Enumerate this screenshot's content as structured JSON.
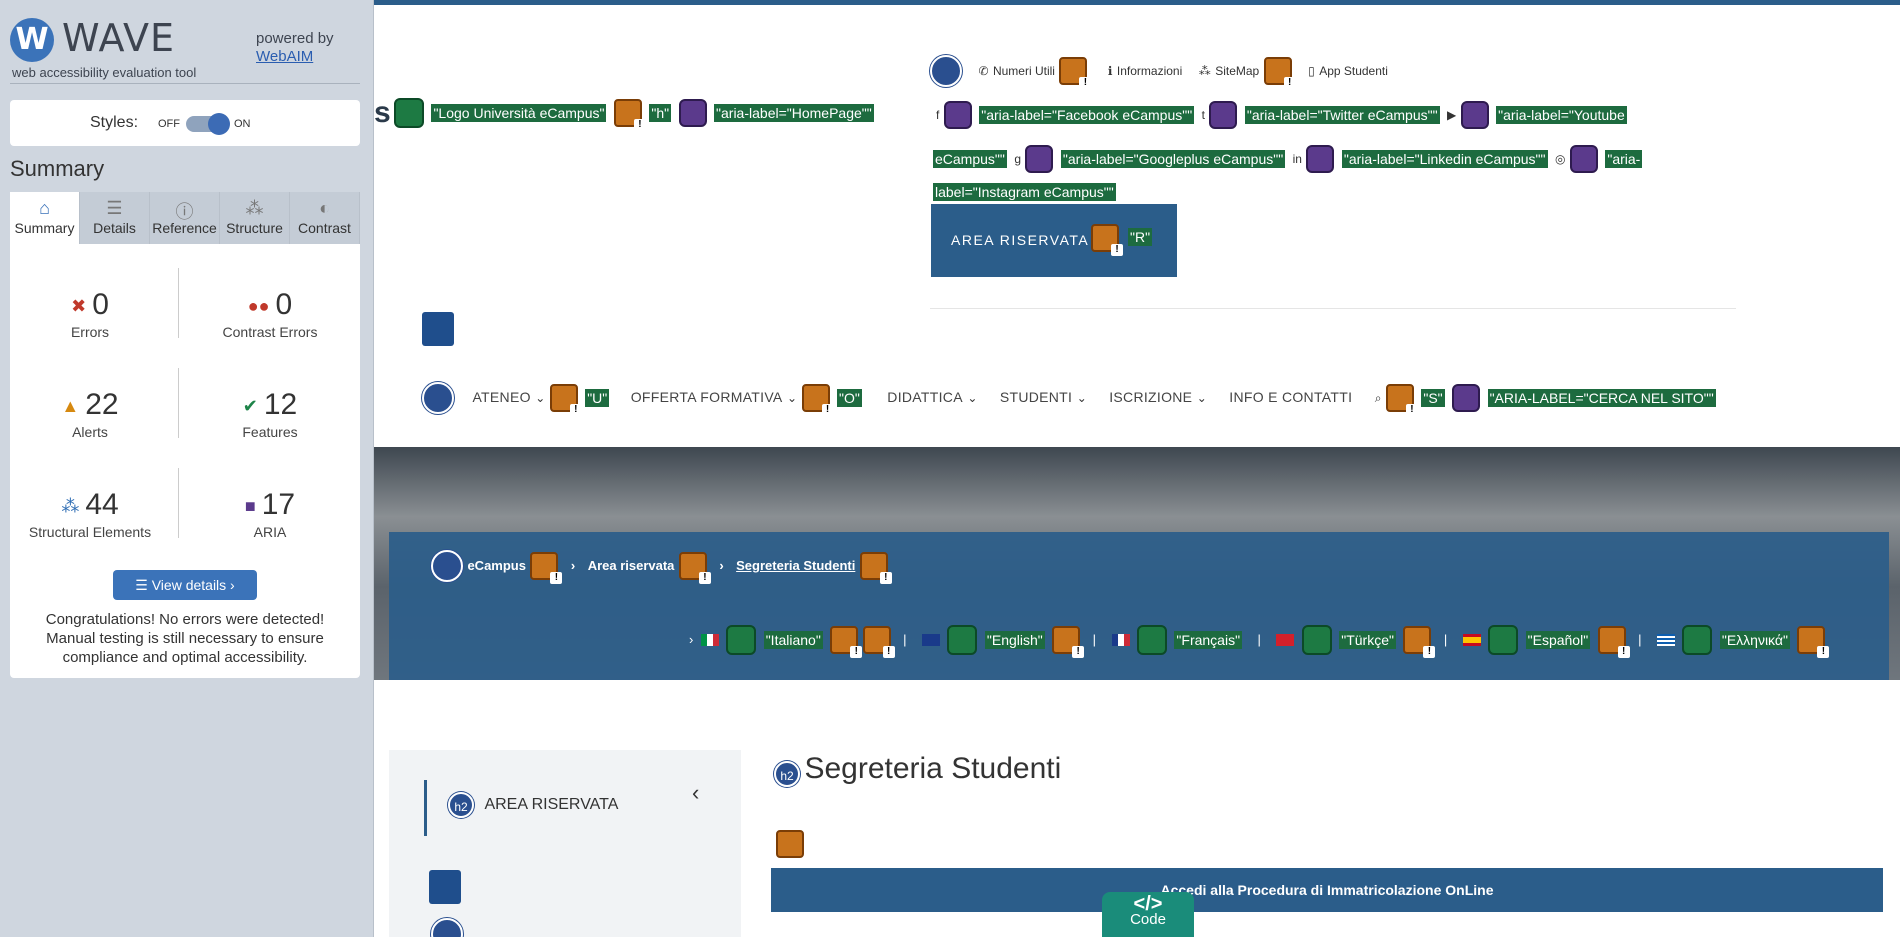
{
  "wave": {
    "word": "WAVE",
    "subtitle": "web accessibility evaluation tool",
    "powered_by": "powered by",
    "webaim_link": "WebAIM",
    "styles_label": "Styles:",
    "styles_off": "OFF",
    "styles_on": "ON",
    "summary_title": "Summary",
    "tabs": [
      {
        "label": "Summary",
        "icon": "home-icon"
      },
      {
        "label": "Details",
        "icon": "list-icon"
      },
      {
        "label": "Reference",
        "icon": "info-icon"
      },
      {
        "label": "Structure",
        "icon": "structure-icon"
      },
      {
        "label": "Contrast",
        "icon": "contrast-icon"
      }
    ],
    "stats": {
      "errors": {
        "value": "0",
        "label": "Errors",
        "color": "#c0392b"
      },
      "contrast_errors": {
        "value": "0",
        "label": "Contrast Errors",
        "color": "#c0392b"
      },
      "alerts": {
        "value": "22",
        "label": "Alerts",
        "color": "#d68910"
      },
      "features": {
        "value": "12",
        "label": "Features",
        "color": "#1e8449"
      },
      "structural": {
        "value": "44",
        "label": "Structural Elements",
        "color": "#2e6db4"
      },
      "aria": {
        "value": "17",
        "label": "ARIA",
        "color": "#5b3a8c"
      }
    },
    "view_details": "View details ›",
    "congrats": "Congratulations! No errors were detected! Manual testing is still necessary to ensure compliance and optimal accessibility."
  },
  "page": {
    "logo_label": "\"Logo Università eCampus\"",
    "logo_h": "\"h\"",
    "logo_aria": "\"aria-label=\"HomePage\"\"",
    "logo_s": "s",
    "top_links": [
      "Numeri Utili",
      "Informazioni",
      "SiteMap",
      "App Studenti"
    ],
    "social": [
      "\"aria-label=\"Facebook eCampus\"\"",
      "\"aria-label=\"Twitter eCampus\"\"",
      "\"aria-label=\"Youtube",
      "eCampus\"\"",
      "\"aria-label=\"Googleplus eCampus\"\"",
      "\"aria-label=\"Linkedin eCampus\"\"",
      "\"aria-",
      "label=\"Instagram eCampus\"\""
    ],
    "area_riservata_btn": "AREA RISERVATA",
    "area_r": "\"R\"",
    "nav": {
      "ateneo": "ATENEO",
      "ateneo_tag": "\"U\"",
      "offerta": "OFFERTA FORMATIVA",
      "offerta_tag": "\"O\"",
      "didattica": "DIDATTICA",
      "studenti": "STUDENTI",
      "iscrizione": "ISCRIZIONE",
      "info": "INFO E CONTATTI",
      "search_tag": "\"S\"",
      "search_aria": "\"ARIA-LABEL=\"CERCA NEL SITO\"\""
    },
    "breadcrumb": [
      "eCampus",
      "Area riservata",
      "Segreteria Studenti"
    ],
    "languages": [
      "\"Italiano\"",
      "\"English\"",
      "\"Français\"",
      "\"Türkçe\"",
      "\"Español\"",
      "\"Ελληνικά\""
    ],
    "side_title": "AREA RISERVATA",
    "main_title": "Segreteria Studenti",
    "cta": "Accedi alla Procedura di Immatricolazione OnLine",
    "code_btn": "Code",
    "code_glyph": "</>",
    "h2": "h2"
  }
}
